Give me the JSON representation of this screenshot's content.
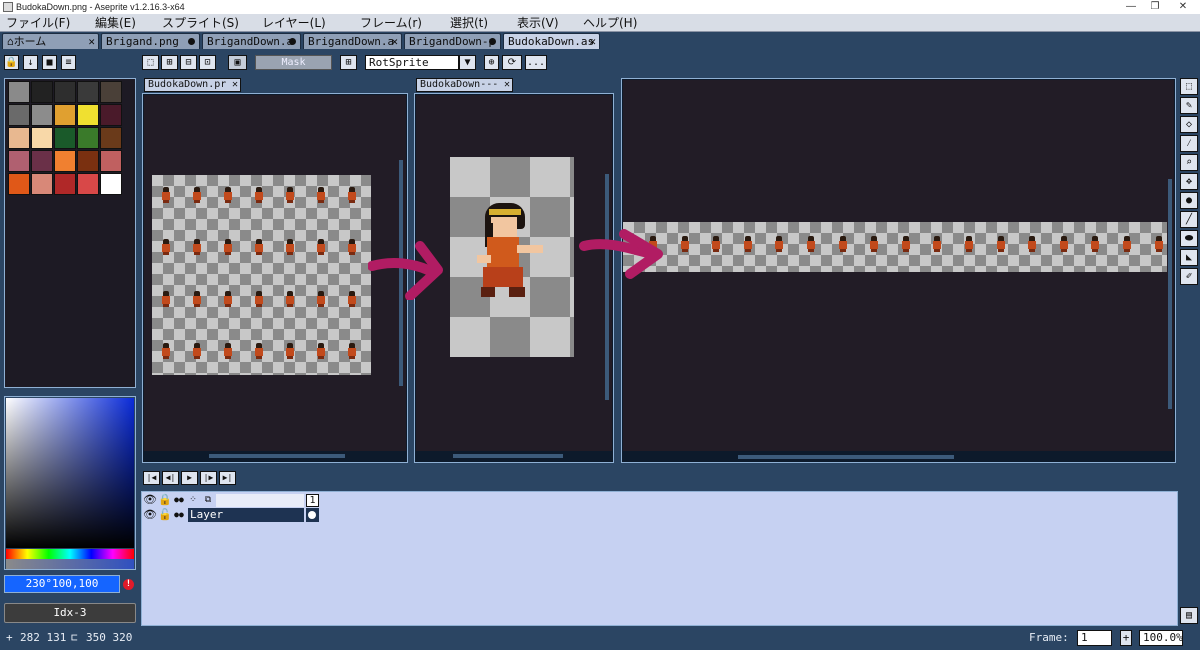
{
  "window": {
    "title": "BudokaDown.png - Aseprite v1.2.16.3-x64",
    "buttons": [
      "—",
      "❐",
      "✕"
    ]
  },
  "menu": [
    "ファイル(F)",
    "編集(E)",
    "スプライト(S)",
    "レイヤー(L)",
    "フレーム(r)",
    "選択(t)",
    "表示(V)",
    "ヘルプ(H)"
  ],
  "tabs": [
    {
      "label": "ホーム",
      "close": "✕"
    },
    {
      "label": "Brigand.png",
      "modified": true
    },
    {
      "label": "BrigandDown.a",
      "modified": true
    },
    {
      "label": "BrigandDown.a",
      "close": "✕"
    },
    {
      "label": "BrigandDown-p",
      "modified": true
    },
    {
      "label": "BudokaDown.as",
      "close": "✕"
    }
  ],
  "toolbar": {
    "mask_label": "Mask",
    "resize_method": "RotSprite",
    "more_label": "..."
  },
  "editors": [
    {
      "tab": "BudokaDown.pr",
      "close": "✕"
    },
    {
      "tab": "BudokaDown---",
      "close": "✕"
    }
  ],
  "color": {
    "hsv_value": "230°100,100",
    "index_label": "Idx-3",
    "warning": "!"
  },
  "palette": [
    "#8a8a8a",
    "#222222",
    "#2e2e2e",
    "#3a3a3a",
    "#4a4038",
    "#6a6a6a",
    "#8c8c8c",
    "#e0a030",
    "#f0e030",
    "#4a1a2a",
    "#e8b890",
    "#f8d8a8",
    "#1a5a2a",
    "#3a7a2a",
    "#6a3a1a",
    "#b06070",
    "#6a3048",
    "#f08030",
    "#7a3010",
    "#c06060",
    "#e05818",
    "#d88878",
    "#b02828",
    "#d84848",
    "#ffffff"
  ],
  "timeline": {
    "frame_header": "1",
    "layer_name": "Layer"
  },
  "status": {
    "cursor_pos": "282 131",
    "selection_size": "350 320",
    "frame_label": "Frame:",
    "frame_value": "1",
    "zoom": "100.0%"
  }
}
